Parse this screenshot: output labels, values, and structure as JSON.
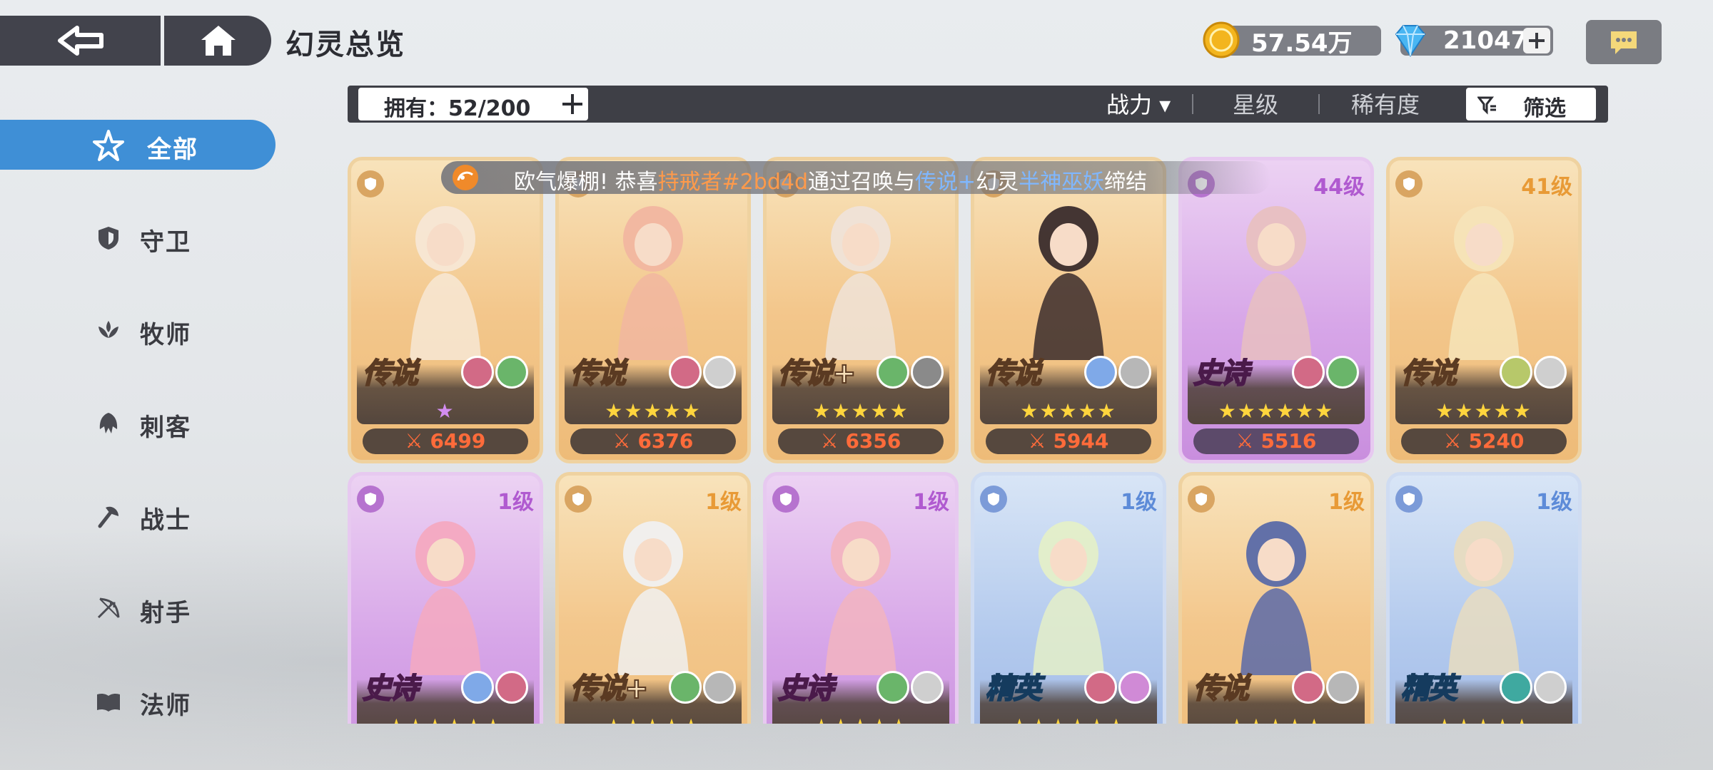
{
  "header": {
    "title": "幻灵总览",
    "gold": "57.54万",
    "gems": "21047"
  },
  "filter": {
    "owned_label": "拥有：52/200",
    "sort_power": "战力 ▾",
    "sort_star": "星级",
    "sort_rarity": "稀有度",
    "filter_label": "筛选"
  },
  "sidebar": {
    "items": [
      {
        "label": "全部",
        "icon": "all-star-icon"
      },
      {
        "label": "守卫",
        "icon": "shield-icon"
      },
      {
        "label": "牧师",
        "icon": "priest-icon"
      },
      {
        "label": "刺客",
        "icon": "assassin-icon"
      },
      {
        "label": "战士",
        "icon": "axe-icon"
      },
      {
        "label": "射手",
        "icon": "bow-icon"
      },
      {
        "label": "法师",
        "icon": "book-icon"
      }
    ]
  },
  "ticker": {
    "p1": "欧气爆棚!  恭喜",
    "player": "持戒者#2bd4d",
    "p2": "通过召唤与",
    "rarity": "传说+",
    "p3": "幻灵",
    "hero": "半神巫妖",
    "p4": "缔结"
  },
  "cards": [
    {
      "rarity": "传说",
      "stars": "★",
      "power": "6499",
      "level": "",
      "bg": "gold"
    },
    {
      "rarity": "传说",
      "stars": "★★★★★",
      "power": "6376",
      "level": "",
      "bg": "gold"
    },
    {
      "rarity": "传说+",
      "stars": "★★★★★",
      "power": "6356",
      "level": "",
      "bg": "gold"
    },
    {
      "rarity": "传说",
      "stars": "★★★★★",
      "power": "5944",
      "level": "",
      "bg": "gold"
    },
    {
      "rarity": "史诗",
      "stars": "★★★★★★",
      "power": "5516",
      "level": "44级",
      "bg": "purple"
    },
    {
      "rarity": "传说",
      "stars": "★★★★★",
      "power": "5240",
      "level": "41级",
      "bg": "gold"
    },
    {
      "rarity": "史诗",
      "stars": "★★★★★★",
      "power": "",
      "level": "1级",
      "bg": "purple"
    },
    {
      "rarity": "传说+",
      "stars": "★★★★★",
      "power": "",
      "level": "1级",
      "bg": "gold"
    },
    {
      "rarity": "史诗",
      "stars": "★★★★★",
      "power": "",
      "level": "1级",
      "bg": "purple"
    },
    {
      "rarity": "精英",
      "stars": "★★★★★★",
      "power": "",
      "level": "1级",
      "bg": "blue"
    },
    {
      "rarity": "传说",
      "stars": "★★★★★",
      "power": "",
      "level": "1级",
      "bg": "gold"
    },
    {
      "rarity": "精英",
      "stars": "★★★★★",
      "power": "",
      "level": "1级",
      "bg": "blue"
    }
  ]
}
